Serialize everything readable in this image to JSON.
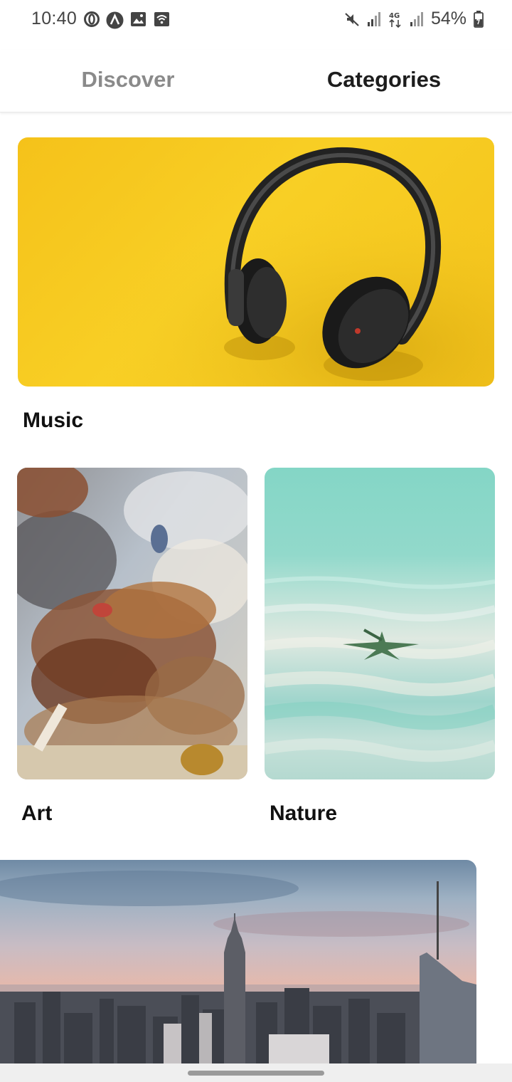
{
  "status_bar": {
    "time": "10:40",
    "battery": "54%",
    "left_icons": [
      "opera-icon",
      "a-icon",
      "image-icon",
      "wifi-calling-icon"
    ],
    "right_icons": [
      "mute-icon",
      "signal-icon",
      "4g-icon",
      "signal-icon",
      "battery-icon"
    ]
  },
  "tabs": [
    {
      "label": "Discover",
      "active": false
    },
    {
      "label": "Categories",
      "active": true
    }
  ],
  "categories": [
    {
      "label": "Music",
      "image": "headphones-photo"
    },
    {
      "label": "Art",
      "image": "painting-photo"
    },
    {
      "label": "Nature",
      "image": "starfish-photo"
    },
    {
      "label": "",
      "image": "city-skyline-photo"
    }
  ],
  "colors": {
    "active_tab": "#1d1d1d",
    "inactive_tab": "#8a8a8a",
    "music_bg": "#f8cf25"
  }
}
